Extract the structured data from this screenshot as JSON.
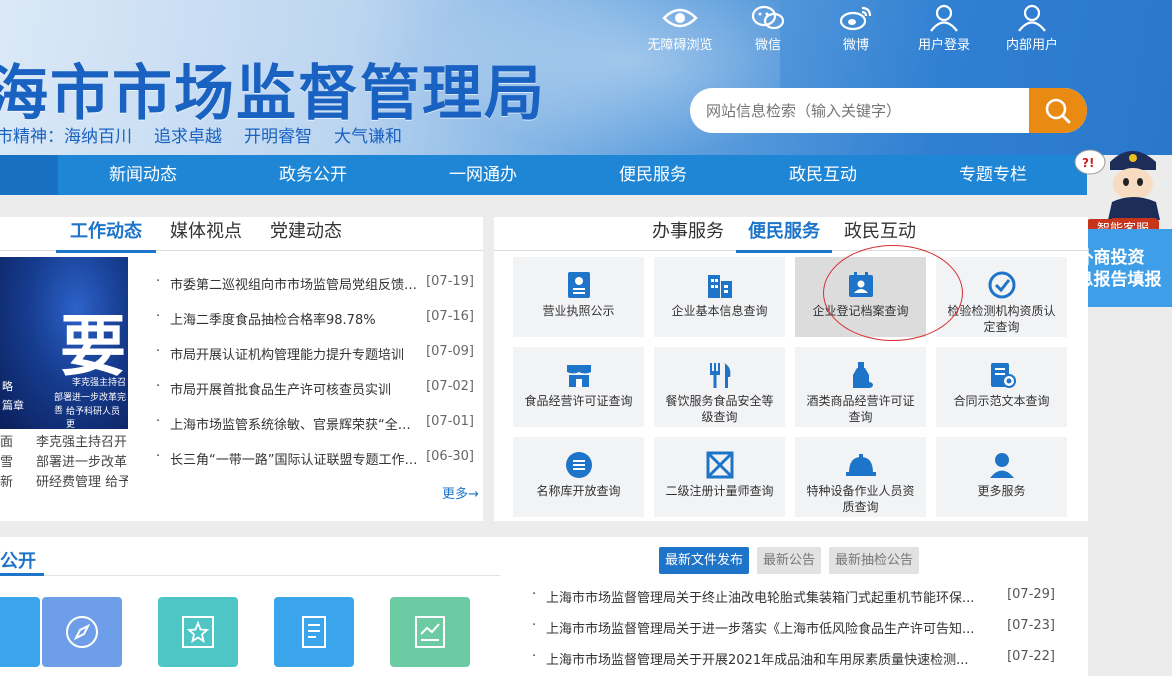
{
  "header": {
    "title": "海市市场监督管理局",
    "slogan": [
      "市精神：海纳百川",
      "追求卓越",
      "开明睿智",
      "大气谦和"
    ],
    "top_icons": [
      {
        "label": "无障碍浏览",
        "icon": "eye-icon"
      },
      {
        "label": "微信",
        "icon": "wechat-icon"
      },
      {
        "label": "微博",
        "icon": "weibo-icon"
      },
      {
        "label": "用户登录",
        "icon": "user-icon"
      },
      {
        "label": "内部用户",
        "icon": "user-icon"
      }
    ],
    "search": {
      "placeholder": "网站信息检索（输入关键字）",
      "icon": "search-icon"
    }
  },
  "nav": [
    "新闻动态",
    "政务公开",
    "一网通办",
    "便民服务",
    "政民互动",
    "专题专栏"
  ],
  "mascot": {
    "label": "智能客服"
  },
  "invest_banner": {
    "line1": "外商投资",
    "line2": "信息报告填报"
  },
  "left_panel": {
    "tabs": [
      "工作动态",
      "媒体视点",
      "党建动态"
    ],
    "active_tab": 0,
    "slide": {
      "big_text": "要",
      "captions": [
        "李克强主持召",
        "部署进一步改革完善",
        "给予科研人员更"
      ],
      "edge": [
        "略",
        "篇章"
      ],
      "bottom_left": [
        "面",
        "雪",
        "新"
      ],
      "bottom_right": [
        "李克强主持召开",
        "部署进一步改革",
        "研经费管理 给予"
      ]
    },
    "news": [
      {
        "title": "市委第二巡视组向市市场监管局党组反馈巡视情况",
        "date": "[07-19]"
      },
      {
        "title": "上海二季度食品抽检合格率98.78%",
        "date": "[07-16]"
      },
      {
        "title": "市局开展认证机构管理能力提升专题培训",
        "date": "[07-09]"
      },
      {
        "title": "市局开展首批食品生产许可核查员实训",
        "date": "[07-02]"
      },
      {
        "title": "上海市场监管系统徐敏、官景辉荣获“全国优秀共产党员”",
        "date": "[07-01]"
      },
      {
        "title": "长三角“一带一路”国际认证联盟专题工作会议召开",
        "date": "[06-30]"
      }
    ],
    "more": "更多→"
  },
  "right_panel": {
    "tabs": [
      "办事服务",
      "便民服务",
      "政民互动"
    ],
    "active_tab": 1,
    "tiles": [
      {
        "label": "营业执照公示",
        "icon": "license-icon"
      },
      {
        "label": "企业基本信息查询",
        "icon": "building-icon"
      },
      {
        "label": "企业登记档案查询",
        "icon": "archive-icon"
      },
      {
        "label": "检验检测机构资质认定查询",
        "icon": "check-badge-icon"
      },
      {
        "label": "食品经营许可证查询",
        "icon": "shop-icon"
      },
      {
        "label": "餐饮服务食品安全等级查询",
        "icon": "fork-knife-icon"
      },
      {
        "label": "酒类商品经营许可证查询",
        "icon": "bottle-icon"
      },
      {
        "label": "合同示范文本查询",
        "icon": "contract-icon"
      },
      {
        "label": "名称库开放查询",
        "icon": "list-circle-icon"
      },
      {
        "label": "二级注册计量师查询",
        "icon": "measure-icon"
      },
      {
        "label": "特种设备作业人员资质查询",
        "icon": "helmet-icon"
      },
      {
        "label": "更多服务",
        "icon": "person-icon"
      }
    ],
    "highlight_index": 2
  },
  "bottom": {
    "section_title": "公开",
    "tiles": [
      {
        "icon": "compass-icon",
        "color": "#6f9ee8"
      },
      {
        "icon": "star-doc-icon",
        "color": "#4fc6c6"
      },
      {
        "icon": "document-icon",
        "color": "#3aa5ea"
      },
      {
        "icon": "chart-doc-icon",
        "color": "#6ccba3"
      }
    ],
    "tabs": [
      "最新文件发布",
      "最新公告",
      "最新抽检公告"
    ],
    "active_tab": 0,
    "docs": [
      {
        "title": "上海市市场监督管理局关于终止油改电轮胎式集装箱门式起重机节能环保...",
        "date": "[07-29]"
      },
      {
        "title": "上海市市场监督管理局关于进一步落实《上海市低风险食品生产许可告知...",
        "date": "[07-23]"
      },
      {
        "title": "上海市市场监督管理局关于开展2021年成品油和车用尿素质量快速检测...",
        "date": "[07-22]"
      }
    ]
  },
  "colors": {
    "primary": "#1e74c8",
    "nav": "#1f86d6",
    "search_button": "#e98a12",
    "annotation": "#d83030"
  }
}
